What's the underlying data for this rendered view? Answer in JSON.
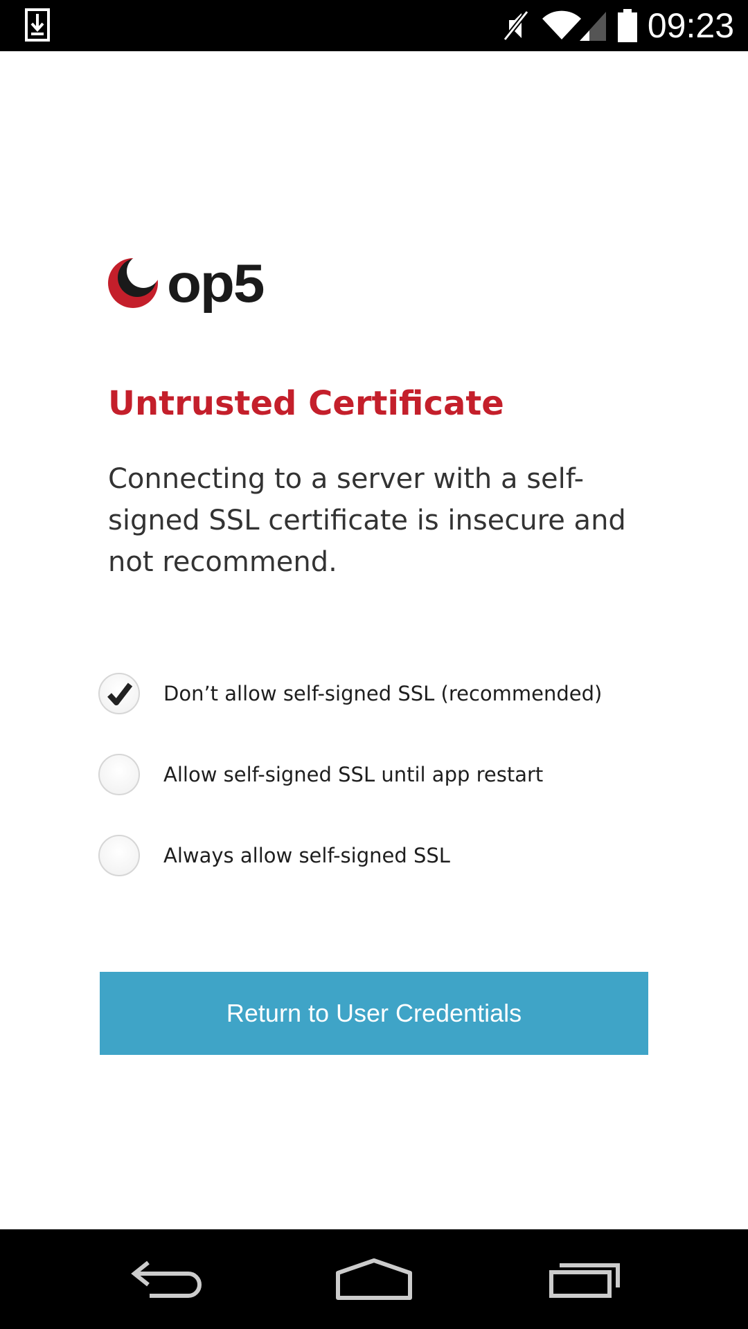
{
  "status_bar": {
    "time": "09:23",
    "icons": [
      "download-notification-icon",
      "muted-icon",
      "wifi-icon",
      "cell-signal-icon",
      "battery-icon"
    ]
  },
  "brand": {
    "logo_text": "op5",
    "logo_colors": {
      "crescent": "#c41f2b",
      "inner": "#1a1a1a"
    }
  },
  "dialog": {
    "title": "Untrusted Certificate",
    "description": "Connecting to a server with a self-signed SSL certificate is insecure and not recommend."
  },
  "options": [
    {
      "label": "Don’t allow self-signed SSL (recommended)",
      "checked": true
    },
    {
      "label": "Allow self-signed SSL until app restart",
      "checked": false
    },
    {
      "label": "Always allow self-signed SSL",
      "checked": false
    }
  ],
  "actions": {
    "return_label": "Return to User Credentials"
  },
  "nav_bar": {
    "icons": [
      "back-icon",
      "home-icon",
      "recent-apps-icon"
    ]
  },
  "colors": {
    "title": "#c41f2b",
    "button": "#3fa4c7",
    "status_bar": "#000000"
  }
}
